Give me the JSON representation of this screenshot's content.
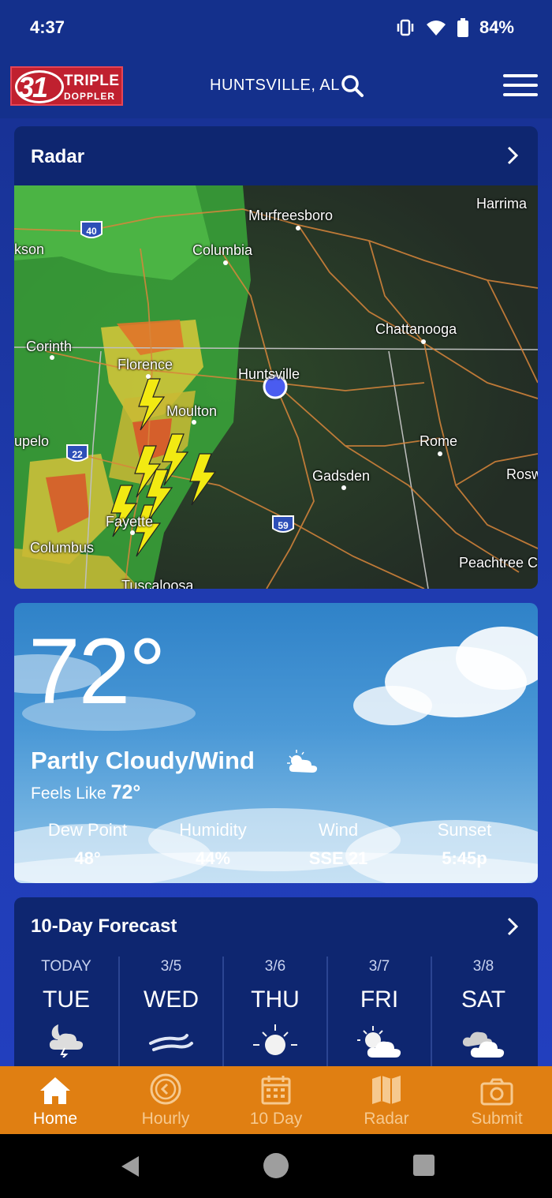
{
  "status": {
    "time": "4:37",
    "battery": "84%"
  },
  "header": {
    "logo_number": "31",
    "logo_line1": "TRIPLE",
    "logo_line2": "DOPPLER",
    "location": "HUNTSVILLE, AL"
  },
  "radar": {
    "title": "Radar",
    "cities": [
      "Murfreesboro",
      "Harrima",
      "kson",
      "Columbia",
      "Chattanooga",
      "Corinth",
      "Florence",
      "Huntsville",
      "Moulton",
      "upelo",
      "Rome",
      "Gadsden",
      "Rosw",
      "Fayette",
      "Columbus",
      "Peachtree C",
      "Tuscaloosa"
    ],
    "highways": [
      "40",
      "22",
      "59"
    ]
  },
  "current": {
    "temperature": "72°",
    "condition": "Partly Cloudy/Wind",
    "feels_label": "Feels Like",
    "feels_value": "72°",
    "stats": [
      {
        "label": "Dew Point",
        "value": "48°"
      },
      {
        "label": "Humidity",
        "value": "44%"
      },
      {
        "label": "Wind",
        "value": "SSE 21"
      },
      {
        "label": "Sunset",
        "value": "5:45p"
      }
    ]
  },
  "forecast": {
    "title": "10-Day Forecast",
    "days": [
      {
        "date": "TODAY",
        "day": "TUE",
        "icon": "thunderstorm-night-icon"
      },
      {
        "date": "3/5",
        "day": "WED",
        "icon": "wind-icon"
      },
      {
        "date": "3/6",
        "day": "THU",
        "icon": "sun-icon"
      },
      {
        "date": "3/7",
        "day": "FRI",
        "icon": "partly-sunny-icon"
      },
      {
        "date": "3/8",
        "day": "SAT",
        "icon": "cloudy-icon"
      }
    ]
  },
  "nav": [
    {
      "label": "Home",
      "icon": "home-icon"
    },
    {
      "label": "Hourly",
      "icon": "clock-icon"
    },
    {
      "label": "10 Day",
      "icon": "calendar-icon"
    },
    {
      "label": "Radar",
      "icon": "map-icon"
    },
    {
      "label": "Submit",
      "icon": "camera-icon"
    }
  ],
  "colors": {
    "header_bg": "#14308c",
    "card_bg": "#0e2670",
    "nav_bg": "#e07f12",
    "logo_red": "#c0202f"
  }
}
